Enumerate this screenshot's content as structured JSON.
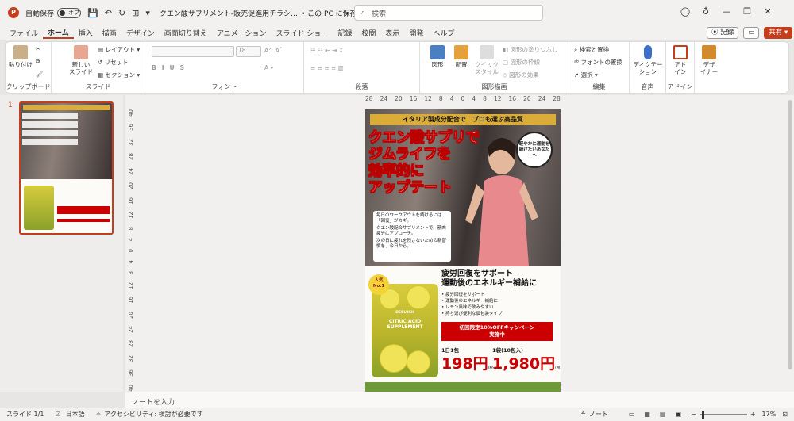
{
  "title": {
    "autosave": "自動保存",
    "toggle": "オフ",
    "doc": "クエン酸サプリメント-販売促進用チラシ…",
    "saved": "• この PC に保存済み ∨",
    "search": "検索"
  },
  "menu": [
    "ファイル",
    "ホーム",
    "挿入",
    "描画",
    "デザイン",
    "画面切り替え",
    "アニメーション",
    "スライド ショー",
    "記録",
    "校閲",
    "表示",
    "開発",
    "ヘルプ"
  ],
  "menu_right": {
    "record": "記録",
    "share": "共有"
  },
  "ribbon": {
    "clipboard": {
      "paste": "貼り付け",
      "label": "クリップボード"
    },
    "slides": {
      "new": "新しい\nスライド",
      "layout": "レイアウト",
      "reset": "リセット",
      "section": "セクション",
      "label": "スライド"
    },
    "font": {
      "size": "18",
      "label": "フォント"
    },
    "paragraph": {
      "label": "段落"
    },
    "drawing": {
      "shape": "図形",
      "arrange": "配置",
      "quick": "クイック\nスタイル",
      "fill": "図形の塗りつぶし",
      "outline": "図形の枠線",
      "effect": "図形の効果",
      "label": "図形描画"
    },
    "edit": {
      "find": "検索と置換",
      "font_replace": "フォントの置換",
      "select": "選択",
      "label": "編集"
    },
    "voice": {
      "dictate": "ディクテー\nション",
      "label": "音声"
    },
    "addin": {
      "addin": "アド\nイン",
      "label": "アドイン"
    },
    "designer": {
      "designer": "デザ\nイナー"
    }
  },
  "ruler": {
    "h": [
      "28",
      "24",
      "20",
      "16",
      "12",
      "8",
      "4",
      "0",
      "4",
      "8",
      "12",
      "16",
      "20",
      "24",
      "28"
    ],
    "v": [
      "40",
      "36",
      "32",
      "28",
      "24",
      "20",
      "16",
      "12",
      "8",
      "4",
      "0",
      "4",
      "8",
      "12",
      "16",
      "20",
      "24",
      "28",
      "32",
      "36",
      "40"
    ]
  },
  "thumb_number": "1",
  "slide": {
    "banner": "イタリア製成分配合で　プロも選ぶ高品質",
    "headline": [
      "クエン酸サプリで",
      "ジムライフを",
      "効率的に",
      "アップテート"
    ],
    "bubble": "軽やかに運動を続けたいあなたへ",
    "info": [
      "毎日のワークアウトを続けるには「回復」がカギ。",
      "クエン酸配合サプリメントで、筋肉疲労にアプローチ。",
      "次の日に疲れを残さないための新習慣を、今日から。"
    ],
    "no1": "人気\nNo.1",
    "brand": "DESLUSH",
    "pack_label": "CITRIC ACID\nSUPPLEMENT",
    "lower_title": "疲労回復をサポート\n運動後のエネルギー補給に",
    "bullets": [
      "疲労回復をサポート",
      "運動後のエネルギー補給に",
      "レモン風味で飲みやすい",
      "持ち運び便利な個包装タイプ"
    ],
    "offer": "初回限定10%OFFキャンペーン\n実施中",
    "price1_label": "1日1包",
    "price1": "198円",
    "price2_label": "1袋(10包入)",
    "price2": "1,980円",
    "tax": "(税込み)"
  },
  "notes": "ノートを入力",
  "status": {
    "slide": "スライド 1/1",
    "lang": "日本語",
    "access": "アクセシビリティ: 検討が必要です",
    "note": "ノート",
    "zoom": "17%"
  }
}
